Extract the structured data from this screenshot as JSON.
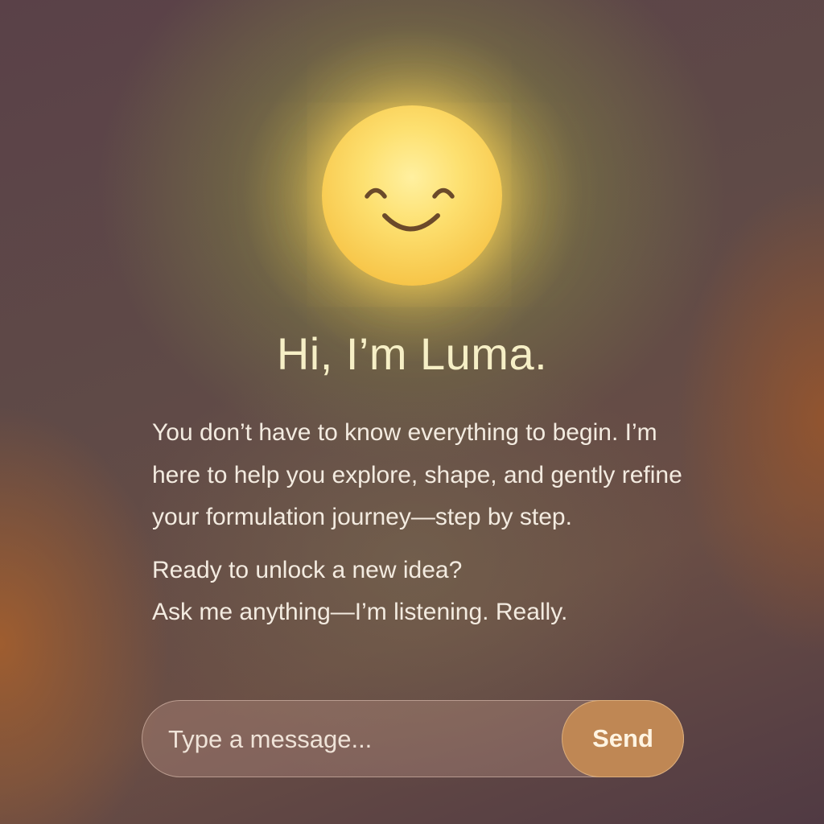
{
  "assistant": {
    "avatar_icon": "smiling-face-icon",
    "greeting": "Hi, I’m Luma."
  },
  "intro": {
    "paragraph_1": "You don’t have to know everything to begin. I’m here to help you explore, shape, and gently refine your formulation journey—step by step.",
    "paragraph_2_line_1": "Ready to unlock a new idea?",
    "paragraph_2_line_2": "Ask me anything—I’m listening. Really."
  },
  "composer": {
    "placeholder": "Type a message...",
    "value": "",
    "send_label": "Send"
  },
  "colors": {
    "avatar_yellow": "#fde070",
    "title_cream": "#f6efc6",
    "send_button": "#bf8754"
  }
}
